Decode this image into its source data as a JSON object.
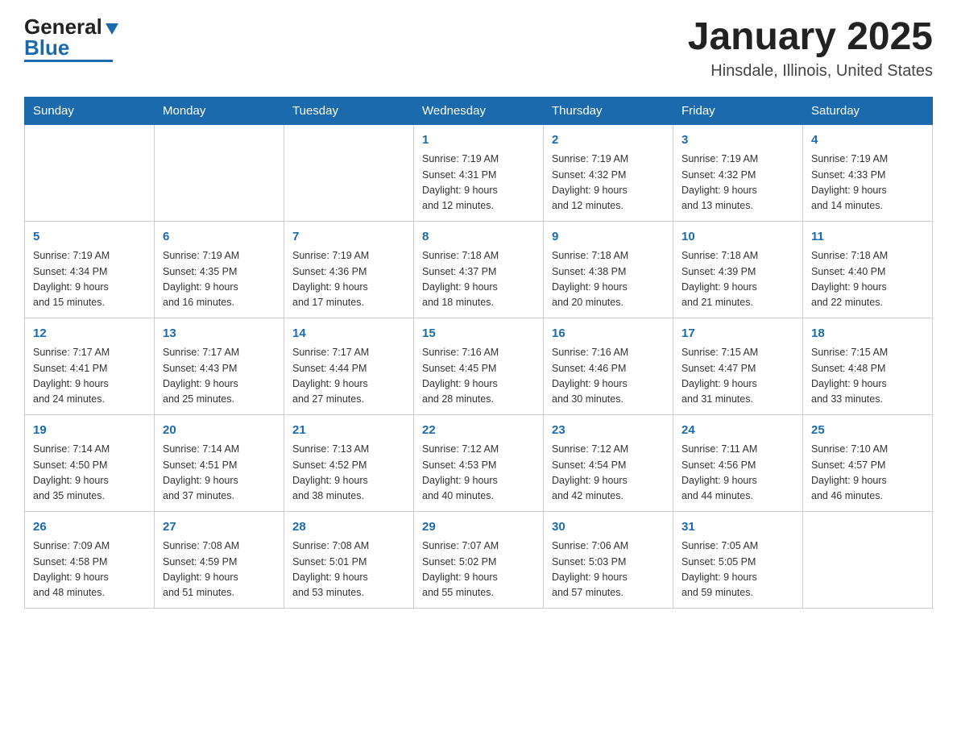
{
  "header": {
    "logo_general": "General",
    "logo_blue": "Blue",
    "title": "January 2025",
    "subtitle": "Hinsdale, Illinois, United States"
  },
  "days_of_week": [
    "Sunday",
    "Monday",
    "Tuesday",
    "Wednesday",
    "Thursday",
    "Friday",
    "Saturday"
  ],
  "weeks": [
    [
      {
        "day": "",
        "info": ""
      },
      {
        "day": "",
        "info": ""
      },
      {
        "day": "",
        "info": ""
      },
      {
        "day": "1",
        "info": "Sunrise: 7:19 AM\nSunset: 4:31 PM\nDaylight: 9 hours\nand 12 minutes."
      },
      {
        "day": "2",
        "info": "Sunrise: 7:19 AM\nSunset: 4:32 PM\nDaylight: 9 hours\nand 12 minutes."
      },
      {
        "day": "3",
        "info": "Sunrise: 7:19 AM\nSunset: 4:32 PM\nDaylight: 9 hours\nand 13 minutes."
      },
      {
        "day": "4",
        "info": "Sunrise: 7:19 AM\nSunset: 4:33 PM\nDaylight: 9 hours\nand 14 minutes."
      }
    ],
    [
      {
        "day": "5",
        "info": "Sunrise: 7:19 AM\nSunset: 4:34 PM\nDaylight: 9 hours\nand 15 minutes."
      },
      {
        "day": "6",
        "info": "Sunrise: 7:19 AM\nSunset: 4:35 PM\nDaylight: 9 hours\nand 16 minutes."
      },
      {
        "day": "7",
        "info": "Sunrise: 7:19 AM\nSunset: 4:36 PM\nDaylight: 9 hours\nand 17 minutes."
      },
      {
        "day": "8",
        "info": "Sunrise: 7:18 AM\nSunset: 4:37 PM\nDaylight: 9 hours\nand 18 minutes."
      },
      {
        "day": "9",
        "info": "Sunrise: 7:18 AM\nSunset: 4:38 PM\nDaylight: 9 hours\nand 20 minutes."
      },
      {
        "day": "10",
        "info": "Sunrise: 7:18 AM\nSunset: 4:39 PM\nDaylight: 9 hours\nand 21 minutes."
      },
      {
        "day": "11",
        "info": "Sunrise: 7:18 AM\nSunset: 4:40 PM\nDaylight: 9 hours\nand 22 minutes."
      }
    ],
    [
      {
        "day": "12",
        "info": "Sunrise: 7:17 AM\nSunset: 4:41 PM\nDaylight: 9 hours\nand 24 minutes."
      },
      {
        "day": "13",
        "info": "Sunrise: 7:17 AM\nSunset: 4:43 PM\nDaylight: 9 hours\nand 25 minutes."
      },
      {
        "day": "14",
        "info": "Sunrise: 7:17 AM\nSunset: 4:44 PM\nDaylight: 9 hours\nand 27 minutes."
      },
      {
        "day": "15",
        "info": "Sunrise: 7:16 AM\nSunset: 4:45 PM\nDaylight: 9 hours\nand 28 minutes."
      },
      {
        "day": "16",
        "info": "Sunrise: 7:16 AM\nSunset: 4:46 PM\nDaylight: 9 hours\nand 30 minutes."
      },
      {
        "day": "17",
        "info": "Sunrise: 7:15 AM\nSunset: 4:47 PM\nDaylight: 9 hours\nand 31 minutes."
      },
      {
        "day": "18",
        "info": "Sunrise: 7:15 AM\nSunset: 4:48 PM\nDaylight: 9 hours\nand 33 minutes."
      }
    ],
    [
      {
        "day": "19",
        "info": "Sunrise: 7:14 AM\nSunset: 4:50 PM\nDaylight: 9 hours\nand 35 minutes."
      },
      {
        "day": "20",
        "info": "Sunrise: 7:14 AM\nSunset: 4:51 PM\nDaylight: 9 hours\nand 37 minutes."
      },
      {
        "day": "21",
        "info": "Sunrise: 7:13 AM\nSunset: 4:52 PM\nDaylight: 9 hours\nand 38 minutes."
      },
      {
        "day": "22",
        "info": "Sunrise: 7:12 AM\nSunset: 4:53 PM\nDaylight: 9 hours\nand 40 minutes."
      },
      {
        "day": "23",
        "info": "Sunrise: 7:12 AM\nSunset: 4:54 PM\nDaylight: 9 hours\nand 42 minutes."
      },
      {
        "day": "24",
        "info": "Sunrise: 7:11 AM\nSunset: 4:56 PM\nDaylight: 9 hours\nand 44 minutes."
      },
      {
        "day": "25",
        "info": "Sunrise: 7:10 AM\nSunset: 4:57 PM\nDaylight: 9 hours\nand 46 minutes."
      }
    ],
    [
      {
        "day": "26",
        "info": "Sunrise: 7:09 AM\nSunset: 4:58 PM\nDaylight: 9 hours\nand 48 minutes."
      },
      {
        "day": "27",
        "info": "Sunrise: 7:08 AM\nSunset: 4:59 PM\nDaylight: 9 hours\nand 51 minutes."
      },
      {
        "day": "28",
        "info": "Sunrise: 7:08 AM\nSunset: 5:01 PM\nDaylight: 9 hours\nand 53 minutes."
      },
      {
        "day": "29",
        "info": "Sunrise: 7:07 AM\nSunset: 5:02 PM\nDaylight: 9 hours\nand 55 minutes."
      },
      {
        "day": "30",
        "info": "Sunrise: 7:06 AM\nSunset: 5:03 PM\nDaylight: 9 hours\nand 57 minutes."
      },
      {
        "day": "31",
        "info": "Sunrise: 7:05 AM\nSunset: 5:05 PM\nDaylight: 9 hours\nand 59 minutes."
      },
      {
        "day": "",
        "info": ""
      }
    ]
  ]
}
